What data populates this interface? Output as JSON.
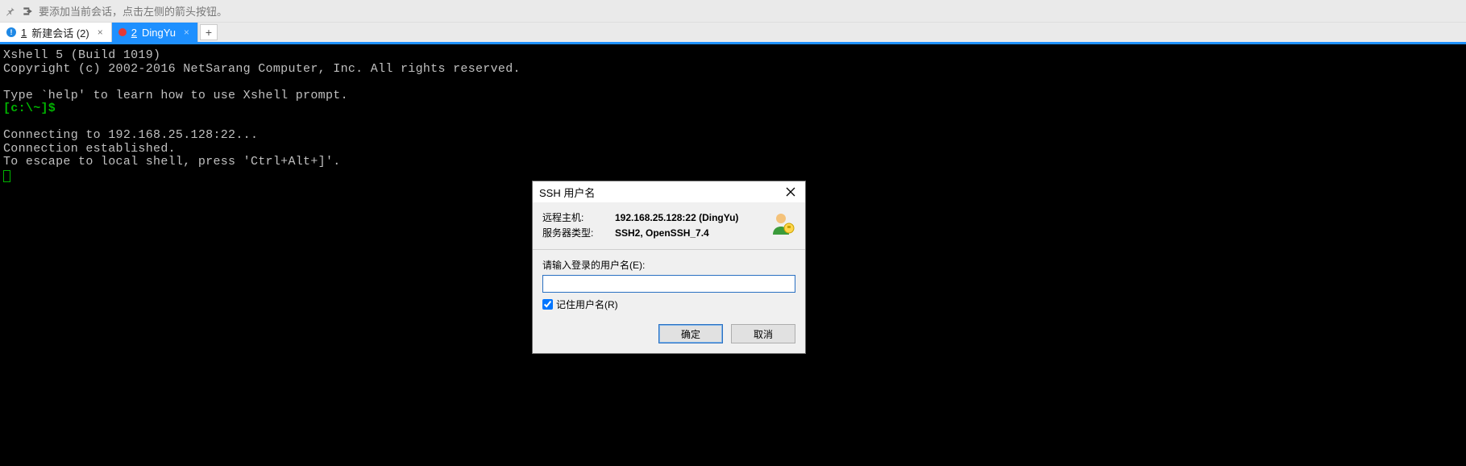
{
  "toolbar": {
    "hint": "要添加当前会话，点击左侧的箭头按钮。"
  },
  "tabs": {
    "items": [
      {
        "index_label": "1",
        "label": "新建会话 (2)",
        "active": false
      },
      {
        "index_label": "2",
        "label": "DingYu",
        "active": true
      }
    ]
  },
  "terminal": {
    "line1": "Xshell 5 (Build 1019)",
    "line2": "Copyright (c) 2002-2016 NetSarang Computer, Inc. All rights reserved.",
    "line3": "",
    "line4": "Type `help' to learn how to use Xshell prompt.",
    "prompt": "[c:\\~]$",
    "line6": "",
    "line7": "Connecting to 192.168.25.128:22...",
    "line8": "Connection established.",
    "line9": "To escape to local shell, press 'Ctrl+Alt+]'."
  },
  "dialog": {
    "title": "SSH 用户名",
    "remote_host_label": "远程主机:",
    "remote_host_value": "192.168.25.128:22 (DingYu)",
    "server_type_label": "服务器类型:",
    "server_type_value": "SSH2, OpenSSH_7.4",
    "username_prompt": "请输入登录的用户名(E):",
    "username_value": "",
    "remember_label": "记住用户名(R)",
    "remember_checked": true,
    "ok_label": "确定",
    "cancel_label": "取消"
  }
}
